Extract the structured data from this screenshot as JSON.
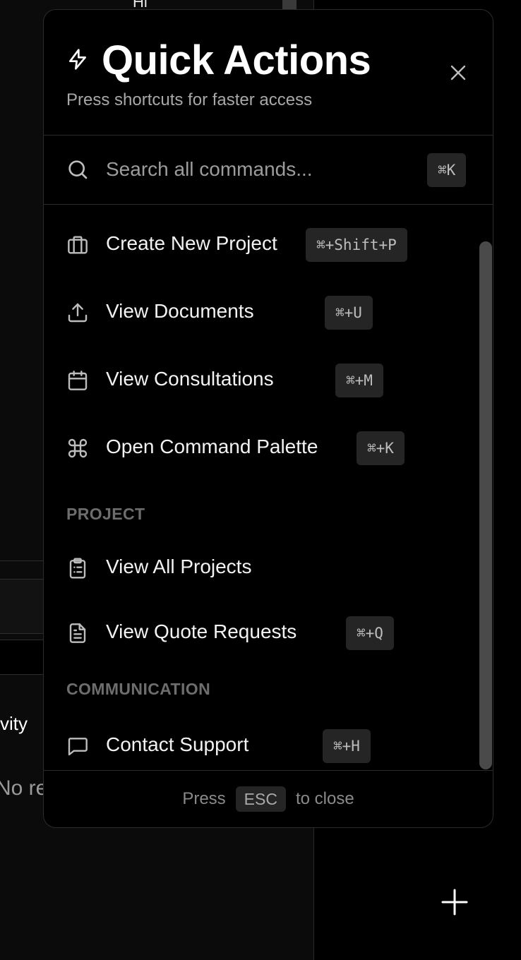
{
  "background": {
    "peek_text": "Hi",
    "activity_text": "vity",
    "empty_text": "No re"
  },
  "panel": {
    "title": "Quick Actions",
    "subtitle": "Press shortcuts for faster access",
    "search": {
      "placeholder": "Search all commands...",
      "shortcut": "⌘K"
    },
    "items": [
      {
        "label": "Create New Project",
        "shortcut": "⌘+Shift+P",
        "icon": "briefcase-icon"
      },
      {
        "label": "View Documents",
        "shortcut": "⌘+U",
        "icon": "upload-icon"
      },
      {
        "label": "View Consultations",
        "shortcut": "⌘+M",
        "icon": "calendar-icon"
      },
      {
        "label": "Open Command Palette",
        "shortcut": "⌘+K",
        "icon": "command-icon"
      }
    ],
    "sections": [
      {
        "title": "PROJECT",
        "items": [
          {
            "label": "View All Projects",
            "icon": "clipboard-icon"
          },
          {
            "label": "View Quote Requests",
            "shortcut": "⌘+Q",
            "icon": "file-text-icon"
          }
        ]
      },
      {
        "title": "COMMUNICATION",
        "items": [
          {
            "label": "Contact Support",
            "shortcut": "⌘+H",
            "icon": "message-square-icon"
          }
        ]
      }
    ],
    "footer": {
      "press": "Press",
      "key": "ESC",
      "suffix": "to close"
    }
  }
}
